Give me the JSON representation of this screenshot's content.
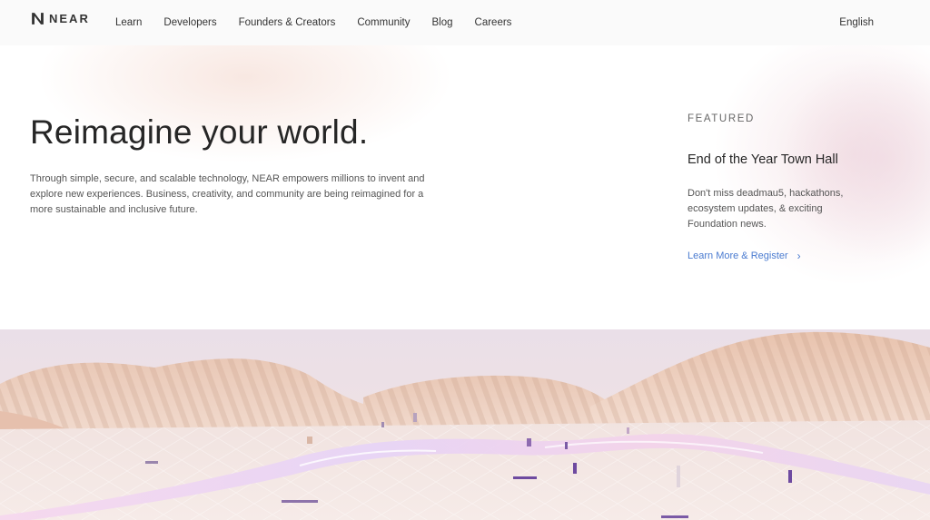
{
  "nav": {
    "logo_text": "NEAR",
    "items": [
      "Learn",
      "Developers",
      "Founders & Creators",
      "Community",
      "Blog",
      "Careers"
    ],
    "language": "English"
  },
  "hero": {
    "headline": "Reimagine your world.",
    "intro": "Through simple, secure, and scalable technology, NEAR empowers millions to invent and explore new experiences. Business, creativity, and community are being reimagined for a more sustainable and inclusive future."
  },
  "featured": {
    "label": "FEATURED",
    "title": "End of the Year Town Hall",
    "description": "Don't miss deadmau5, hackathons, ecosystem updates, & exciting Foundation news.",
    "link": "Learn More & Register",
    "link_icon": "chevron-right-icon"
  },
  "colors": {
    "link": "#4a7bd0",
    "text": "#262626",
    "nav_bg": "#fafafa"
  }
}
